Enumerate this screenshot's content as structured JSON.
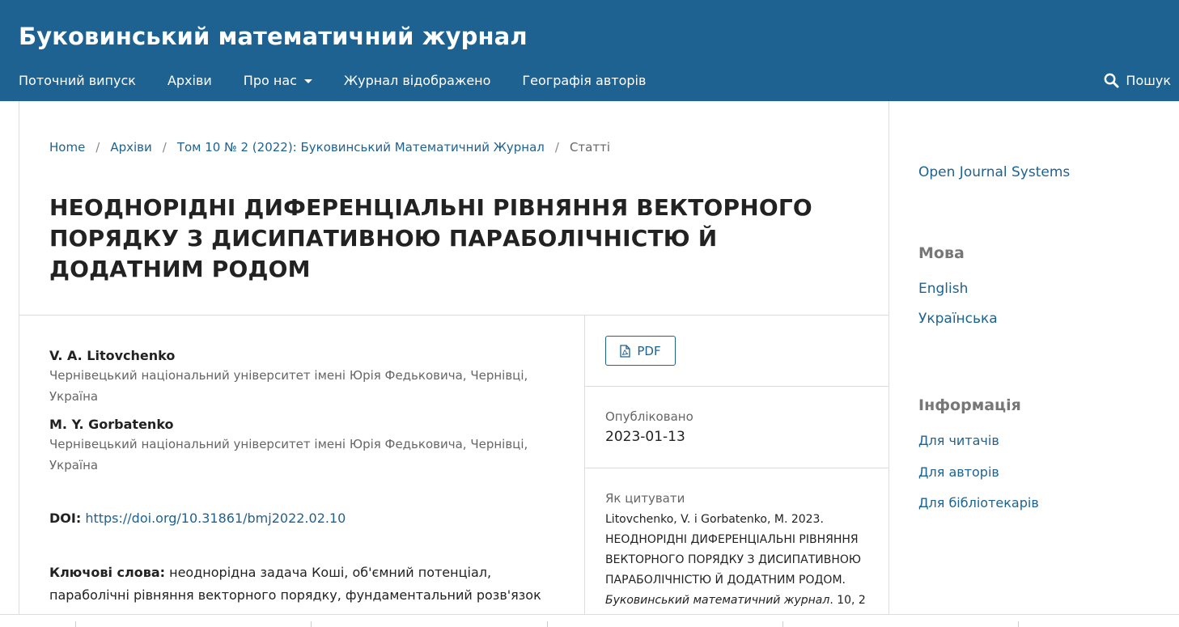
{
  "header": {
    "site_title": "Буковинський математичний журнал",
    "bg_color": "#1e6292",
    "nav": [
      {
        "label": "Поточний випуск"
      },
      {
        "label": "Архіви"
      },
      {
        "label": "Про нас",
        "has_dropdown": true
      },
      {
        "label": "Журнал відображено"
      },
      {
        "label": "Географія авторів"
      }
    ],
    "search_label": "Пошук",
    "search_icon": "search-icon"
  },
  "breadcrumb": {
    "items": [
      "Home",
      "Архіви",
      "Том 10 № 2 (2022): Буковинський Математичний Журнал"
    ],
    "separator": "/",
    "current": "Статті"
  },
  "article": {
    "title": "НЕОДНОРІДНІ ДИФЕРЕНЦІАЛЬНІ РІВНЯННЯ ВЕКТОРНОГО ПОРЯДКУ З ДИСИПАТИВНОЮ ПАРАБОЛІЧНІСТЮ Й ДОДАТНИМ РОДОМ",
    "authors": [
      {
        "name": "V. A. Litovchenko",
        "affiliation": "Чернівецький національний університет імені Юрія Федьковича, Чернівці, Україна"
      },
      {
        "name": "M. Y. Gorbatenko",
        "affiliation": "Чернівецький національний університет імені Юрія Федьковича, Чернівці, Україна"
      }
    ],
    "doi_label": "DOI:",
    "doi_url": "https://doi.org/10.31861/bmj2022.02.10",
    "keywords_label": "Ключові слова:",
    "keywords": "неоднорідна задача Коші, об'ємний потенціал, параболічні рівняння векторного порядку, фундаментальний розв'язок"
  },
  "details": {
    "pdf_label": "PDF",
    "pdf_icon": "file-pdf-icon",
    "published_label": "Опубліковано",
    "published_date": "2023-01-13",
    "cite_label": "Як цитувати",
    "cite_text": "Litovchenko, V. і Gorbatenko, M. 2023. НЕОДНОРІДНІ ДИФЕРЕНЦІАЛЬНІ РІВНЯННЯ ВЕКТОРНОГО ПОРЯДКУ З ДИСИПАТИВНОЮ ПАРАБОЛІЧНІСТЮ Й ДОДАТНИМ РОДОМ.",
    "cite_journal": "Буковинський математичний журнал",
    "cite_tail": ". 10, 2"
  },
  "sidebar": {
    "ojs_link": "Open Journal Systems",
    "language_heading": "Мова",
    "languages": [
      "English",
      "Українська"
    ],
    "info_heading": "Інформація",
    "info_links": [
      "Для читачів",
      "Для авторів",
      "Для бібліотекарів"
    ]
  }
}
